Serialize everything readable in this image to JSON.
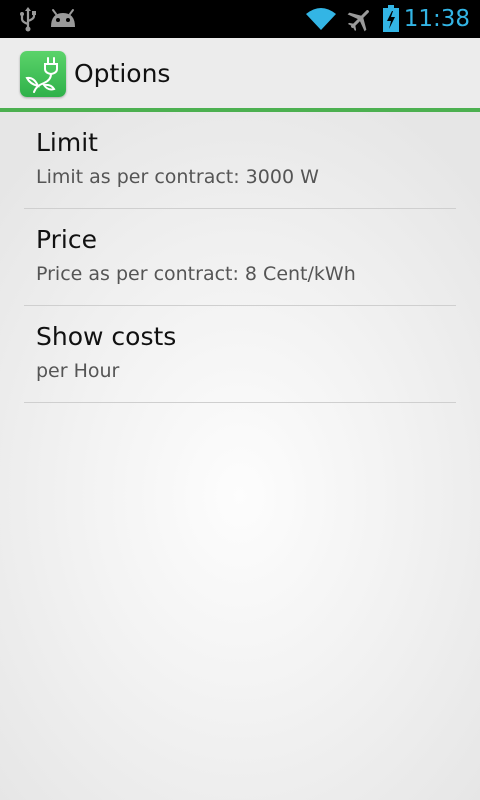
{
  "status_bar": {
    "time": "11:38",
    "icons": [
      "usb-icon",
      "android-debug-icon",
      "wifi-icon",
      "airplane-mode-icon",
      "battery-charging-icon"
    ],
    "accent_color": "#33b5e5"
  },
  "action_bar": {
    "title": "Options",
    "app_icon": "plug-leaf-icon",
    "accent_color": "#4cb050"
  },
  "preferences": [
    {
      "title": "Limit",
      "summary": "Limit as per contract: 3000 W"
    },
    {
      "title": "Price",
      "summary": "Price as per contract: 8 Cent/kWh"
    },
    {
      "title": "Show costs",
      "summary": "per Hour"
    }
  ]
}
